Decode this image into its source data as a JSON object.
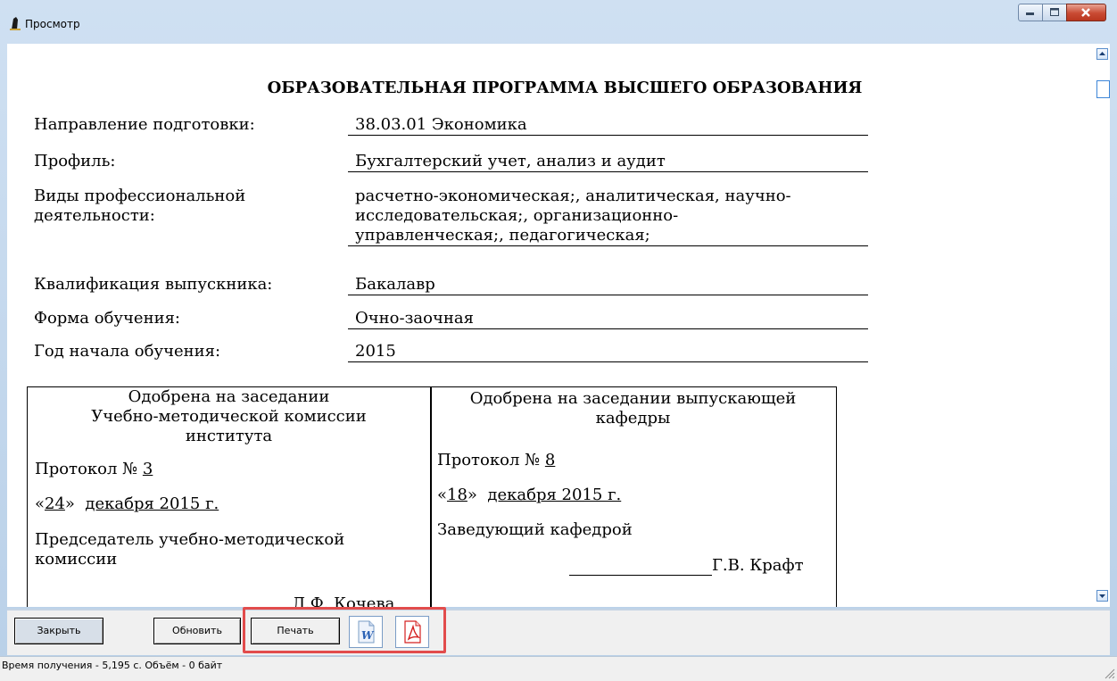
{
  "window": {
    "title": "Просмотр",
    "caption_buttons": [
      "minimize-icon",
      "maximize-icon",
      "close-icon"
    ]
  },
  "document": {
    "heading": "ОБРАЗОВАТЕЛЬНАЯ ПРОГРАММА ВЫСШЕГО ОБРАЗОВАНИЯ",
    "fields": [
      {
        "label": "Направление подготовки:",
        "value": "38.03.01 Экономика"
      },
      {
        "label": "Профиль:",
        "value": "Бухгалтерский учет, анализ и аудит"
      },
      {
        "label_lines": [
          "Виды профессиональной",
          "деятельности:"
        ],
        "value_lines": [
          "расчетно-экономическая;, аналитическая, научно-",
          "исследовательская;, организационно-",
          "управленческая;, педагогическая;"
        ]
      },
      {
        "label": "Квалификация выпускника:",
        "value": "Бакалавр"
      },
      {
        "label": "Форма обучения:",
        "value": "Очно-заочная"
      },
      {
        "label": "Год начала обучения:",
        "value": "2015"
      }
    ],
    "approval": {
      "left": {
        "heading_lines": [
          "Одобрена на заседании",
          "Учебно-методической комиссии",
          "института"
        ],
        "protocol_label": "Протокол №",
        "protocol_number": "3",
        "date_open": "«",
        "date_day": "24",
        "date_close": "»",
        "date_rest": "декабря  2015 г.",
        "role_lines": [
          "Председатель учебно-методической",
          "комиссии"
        ],
        "signer": "Л.Ф. Кочева"
      },
      "right": {
        "heading_lines": [
          "Одобрена на заседании выпускающей",
          "кафедры"
        ],
        "protocol_label": "Протокол №",
        "protocol_number": "8",
        "date_open": "«",
        "date_day": "18",
        "date_close": "»",
        "date_rest": "декабря  2015 г.",
        "role": "Заведующий кафедрой",
        "signer": "Г.В. Крафт"
      }
    }
  },
  "toolbar": {
    "close_label": "Закрыть",
    "refresh_label": "Обновить",
    "print_label": "Печать",
    "export_word_icon": "word-icon",
    "export_pdf_icon": "pdf-icon"
  },
  "status": {
    "text": "Время получения - 5,195 с. Объём - 0 байт"
  },
  "colors": {
    "highlight": "#e24c4c",
    "titlebar": "#cfe0f2",
    "word_blue": "#2b62b5",
    "pdf_red": "#d42020"
  }
}
